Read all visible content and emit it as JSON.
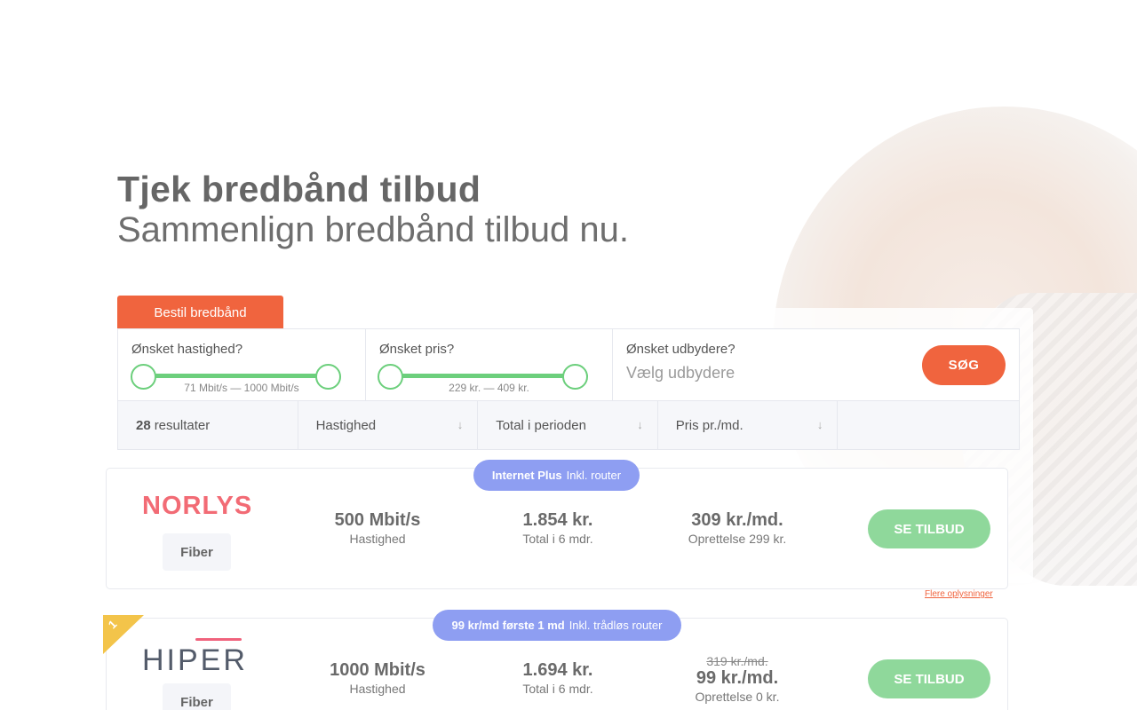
{
  "hero": {
    "title": "Tjek bredbånd tilbud",
    "subtitle": "Sammenlign bredbånd tilbud nu."
  },
  "tabs": {
    "order_label": "Bestil bredbånd"
  },
  "filters": {
    "speed": {
      "label": "Ønsket hastighed?",
      "range": "71 Mbit/s — 1000 Mbit/s"
    },
    "price": {
      "label": "Ønsket pris?",
      "range": "229 kr. — 409 kr."
    },
    "provider": {
      "label": "Ønsket udbydere?",
      "placeholder": "Vælg udbydere"
    },
    "search_label": "SØG"
  },
  "sort": {
    "count": "28",
    "count_label": "resultater",
    "columns": [
      "Hastighed",
      "Total i perioden",
      "Pris pr./md."
    ],
    "arrow": "↓"
  },
  "offers": [
    {
      "badge_strong": "Internet Plus",
      "badge_text": "Inkl. router",
      "provider": "NORLYS",
      "tech": "Fiber",
      "speed": "500 Mbit/s",
      "speed_label": "Hastighed",
      "total": "1.854 kr.",
      "total_label": "Total i 6 mdr.",
      "price": "309 kr./md.",
      "price_label": "Oprettelse 299 kr.",
      "button": "SE TILBUD",
      "more_info": "Flere oplysninger"
    },
    {
      "rank": "1",
      "badge_strong": "99 kr/md første 1 md",
      "badge_text": "Inkl. trådløs router",
      "provider": "HIPER",
      "tech": "Fiber",
      "speed": "1000 Mbit/s",
      "speed_label": "Hastighed",
      "total": "1.694 kr.",
      "total_label": "Total i 6 mdr.",
      "old_price": "319 kr./md.",
      "price": "99 kr./md.",
      "price_label": "Oprettelse 0 kr.",
      "button": "SE TILBUD"
    }
  ],
  "colors": {
    "accent": "#f0643e",
    "slider": "#6ccf7c",
    "badge": "#8e9ef2",
    "cta": "#8fd89b"
  }
}
